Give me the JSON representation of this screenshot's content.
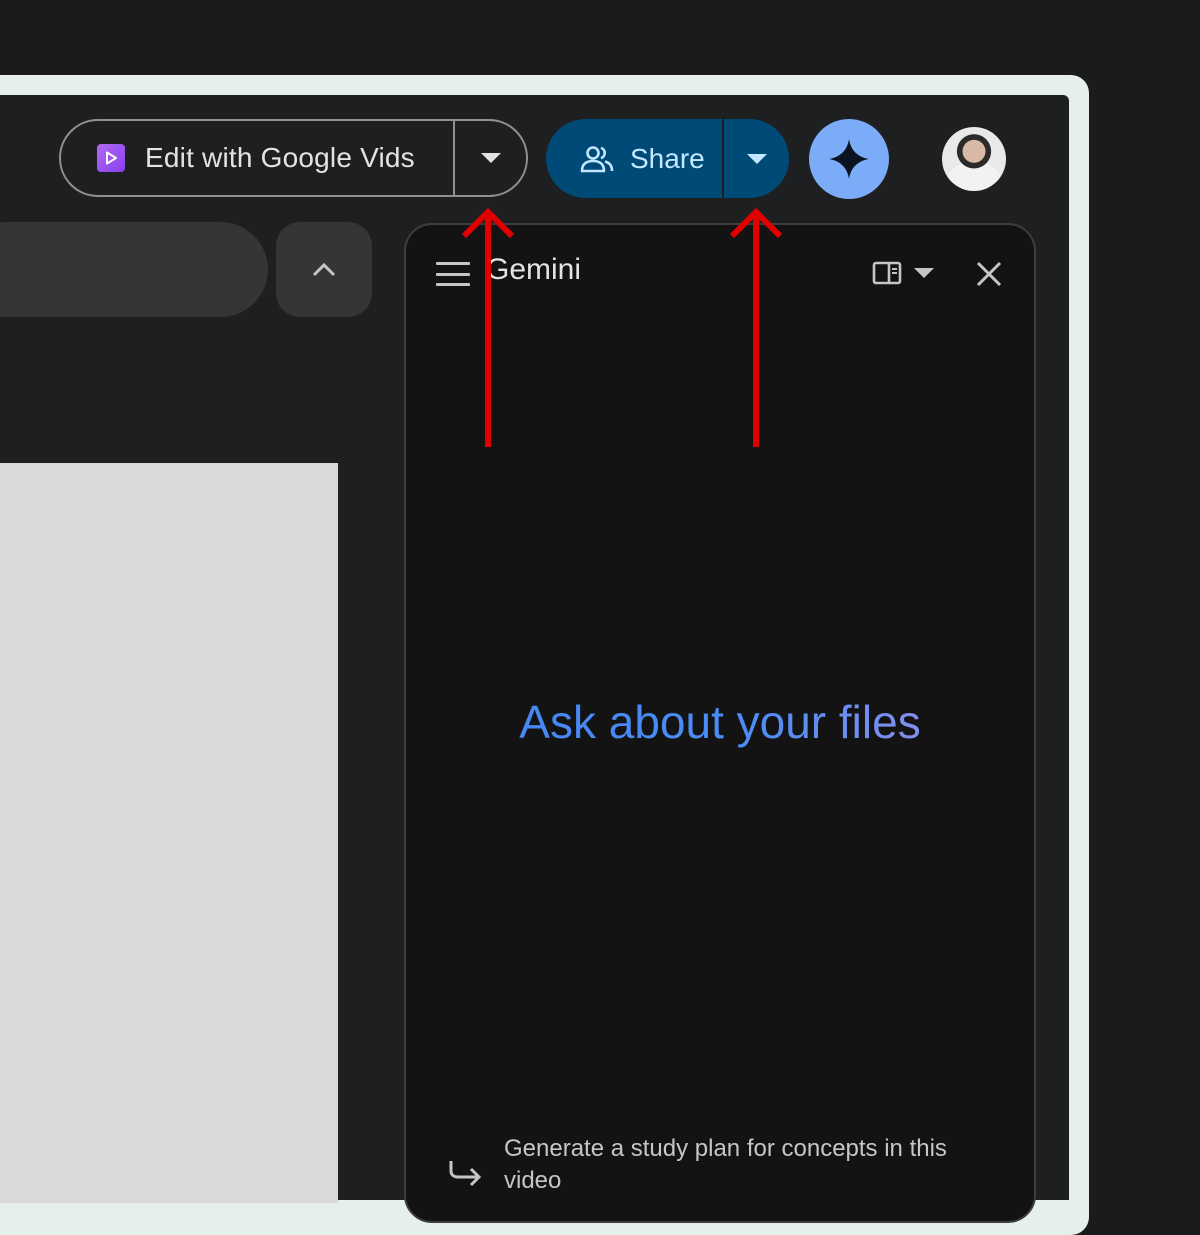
{
  "toolbar": {
    "vids_label": "Edit with Google Vids",
    "share_label": "Share"
  },
  "gemini_panel": {
    "title": "Gemini",
    "hero_text": "Ask about your files",
    "suggestion": "Generate a study plan for concepts in this video"
  },
  "icons": {
    "vids": "google-vids-icon",
    "share": "people-icon",
    "gemini": "gemini-sparkle-icon",
    "collapse": "chevron-up-icon",
    "menu": "hamburger-menu-icon",
    "layout": "side-panel-layout-icon",
    "close": "close-icon",
    "suggestion": "redo-arrow-icon"
  },
  "colors": {
    "background": "#1b1b1c",
    "share_button": "#004a77",
    "share_text": "#c2e7ff",
    "gemini_button": "#7cacf8",
    "hero_start": "#4285f4",
    "hero_end": "#a88ee8",
    "annotation_arrow": "#e00000"
  }
}
